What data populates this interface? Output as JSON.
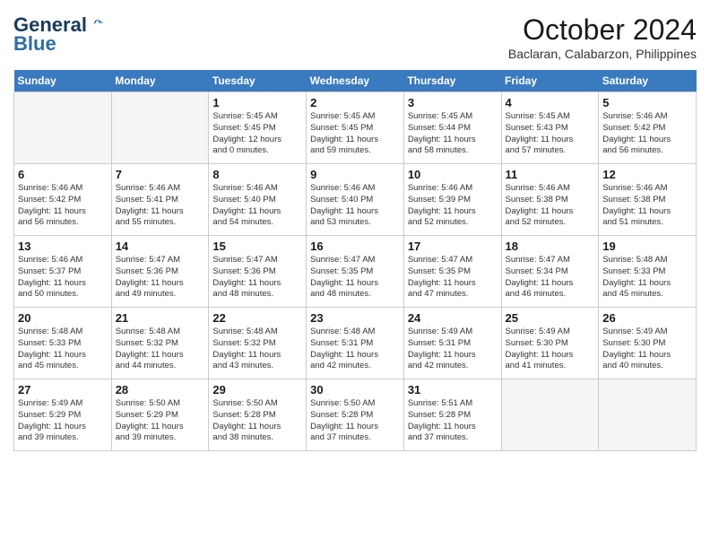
{
  "logo": {
    "general": "General",
    "blue": "Blue"
  },
  "header": {
    "month": "October 2024",
    "location": "Baclaran, Calabarzon, Philippines"
  },
  "weekdays": [
    "Sunday",
    "Monday",
    "Tuesday",
    "Wednesday",
    "Thursday",
    "Friday",
    "Saturday"
  ],
  "weeks": [
    [
      {
        "day": "",
        "info": ""
      },
      {
        "day": "",
        "info": ""
      },
      {
        "day": "1",
        "info": "Sunrise: 5:45 AM\nSunset: 5:45 PM\nDaylight: 12 hours\nand 0 minutes."
      },
      {
        "day": "2",
        "info": "Sunrise: 5:45 AM\nSunset: 5:45 PM\nDaylight: 11 hours\nand 59 minutes."
      },
      {
        "day": "3",
        "info": "Sunrise: 5:45 AM\nSunset: 5:44 PM\nDaylight: 11 hours\nand 58 minutes."
      },
      {
        "day": "4",
        "info": "Sunrise: 5:45 AM\nSunset: 5:43 PM\nDaylight: 11 hours\nand 57 minutes."
      },
      {
        "day": "5",
        "info": "Sunrise: 5:46 AM\nSunset: 5:42 PM\nDaylight: 11 hours\nand 56 minutes."
      }
    ],
    [
      {
        "day": "6",
        "info": "Sunrise: 5:46 AM\nSunset: 5:42 PM\nDaylight: 11 hours\nand 56 minutes."
      },
      {
        "day": "7",
        "info": "Sunrise: 5:46 AM\nSunset: 5:41 PM\nDaylight: 11 hours\nand 55 minutes."
      },
      {
        "day": "8",
        "info": "Sunrise: 5:46 AM\nSunset: 5:40 PM\nDaylight: 11 hours\nand 54 minutes."
      },
      {
        "day": "9",
        "info": "Sunrise: 5:46 AM\nSunset: 5:40 PM\nDaylight: 11 hours\nand 53 minutes."
      },
      {
        "day": "10",
        "info": "Sunrise: 5:46 AM\nSunset: 5:39 PM\nDaylight: 11 hours\nand 52 minutes."
      },
      {
        "day": "11",
        "info": "Sunrise: 5:46 AM\nSunset: 5:38 PM\nDaylight: 11 hours\nand 52 minutes."
      },
      {
        "day": "12",
        "info": "Sunrise: 5:46 AM\nSunset: 5:38 PM\nDaylight: 11 hours\nand 51 minutes."
      }
    ],
    [
      {
        "day": "13",
        "info": "Sunrise: 5:46 AM\nSunset: 5:37 PM\nDaylight: 11 hours\nand 50 minutes."
      },
      {
        "day": "14",
        "info": "Sunrise: 5:47 AM\nSunset: 5:36 PM\nDaylight: 11 hours\nand 49 minutes."
      },
      {
        "day": "15",
        "info": "Sunrise: 5:47 AM\nSunset: 5:36 PM\nDaylight: 11 hours\nand 48 minutes."
      },
      {
        "day": "16",
        "info": "Sunrise: 5:47 AM\nSunset: 5:35 PM\nDaylight: 11 hours\nand 48 minutes."
      },
      {
        "day": "17",
        "info": "Sunrise: 5:47 AM\nSunset: 5:35 PM\nDaylight: 11 hours\nand 47 minutes."
      },
      {
        "day": "18",
        "info": "Sunrise: 5:47 AM\nSunset: 5:34 PM\nDaylight: 11 hours\nand 46 minutes."
      },
      {
        "day": "19",
        "info": "Sunrise: 5:48 AM\nSunset: 5:33 PM\nDaylight: 11 hours\nand 45 minutes."
      }
    ],
    [
      {
        "day": "20",
        "info": "Sunrise: 5:48 AM\nSunset: 5:33 PM\nDaylight: 11 hours\nand 45 minutes."
      },
      {
        "day": "21",
        "info": "Sunrise: 5:48 AM\nSunset: 5:32 PM\nDaylight: 11 hours\nand 44 minutes."
      },
      {
        "day": "22",
        "info": "Sunrise: 5:48 AM\nSunset: 5:32 PM\nDaylight: 11 hours\nand 43 minutes."
      },
      {
        "day": "23",
        "info": "Sunrise: 5:48 AM\nSunset: 5:31 PM\nDaylight: 11 hours\nand 42 minutes."
      },
      {
        "day": "24",
        "info": "Sunrise: 5:49 AM\nSunset: 5:31 PM\nDaylight: 11 hours\nand 42 minutes."
      },
      {
        "day": "25",
        "info": "Sunrise: 5:49 AM\nSunset: 5:30 PM\nDaylight: 11 hours\nand 41 minutes."
      },
      {
        "day": "26",
        "info": "Sunrise: 5:49 AM\nSunset: 5:30 PM\nDaylight: 11 hours\nand 40 minutes."
      }
    ],
    [
      {
        "day": "27",
        "info": "Sunrise: 5:49 AM\nSunset: 5:29 PM\nDaylight: 11 hours\nand 39 minutes."
      },
      {
        "day": "28",
        "info": "Sunrise: 5:50 AM\nSunset: 5:29 PM\nDaylight: 11 hours\nand 39 minutes."
      },
      {
        "day": "29",
        "info": "Sunrise: 5:50 AM\nSunset: 5:28 PM\nDaylight: 11 hours\nand 38 minutes."
      },
      {
        "day": "30",
        "info": "Sunrise: 5:50 AM\nSunset: 5:28 PM\nDaylight: 11 hours\nand 37 minutes."
      },
      {
        "day": "31",
        "info": "Sunrise: 5:51 AM\nSunset: 5:28 PM\nDaylight: 11 hours\nand 37 minutes."
      },
      {
        "day": "",
        "info": ""
      },
      {
        "day": "",
        "info": ""
      }
    ]
  ]
}
